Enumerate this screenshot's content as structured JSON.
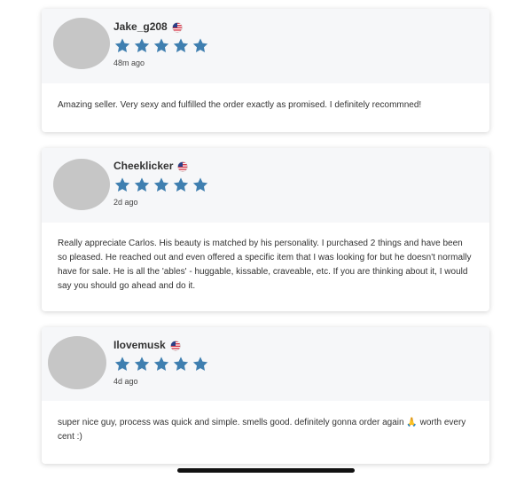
{
  "reviews": [
    {
      "username": "Jake_g208",
      "flag": "us-flag",
      "rating": 5,
      "time": "48m ago",
      "text": "Amazing seller. Very sexy and fulfilled the order exactly as promised. I definitely recommned!"
    },
    {
      "username": "Cheeklicker",
      "flag": "us-flag",
      "rating": 5,
      "time": "2d ago",
      "text": "Really appreciate Carlos. His beauty is matched by his personality. I purchased 2 things and have been so pleased. He reached out and even offered a specific item that I was looking for but he doesn't normally have for sale. He is all the 'ables' - huggable, kissable, craveable, etc. If you are thinking about it, I would say you should go ahead and do it."
    },
    {
      "username": "Ilovemusk",
      "flag": "us-flag",
      "rating": 5,
      "time": "4d ago",
      "text": "super nice guy, process was quick and simple. smells good. definitely gonna order again 🙏 worth every cent :)"
    }
  ],
  "colors": {
    "star": "#3f7fb0",
    "avatar": "#c6c6c6",
    "header_bg": "#f6f7f9"
  }
}
